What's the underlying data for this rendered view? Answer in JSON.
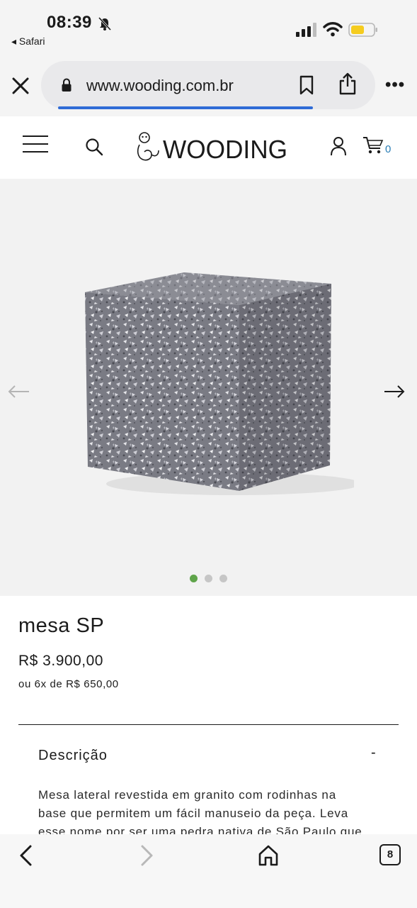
{
  "status_bar": {
    "time": "08:39",
    "back_app": "◂ Safari",
    "icons": [
      "bell-slash-icon",
      "signal-icon",
      "wifi-icon",
      "battery-icon"
    ]
  },
  "browser": {
    "url": "www.wooding.com.br",
    "load_progress": 0.85,
    "icons": [
      "close-icon",
      "lock-icon",
      "bookmark-icon",
      "share-icon",
      "more-icon"
    ],
    "more_label": "•••"
  },
  "site_header": {
    "logo_text": "WOODING",
    "cart_count": "0",
    "icons": [
      "menu-icon",
      "search-icon",
      "user-icon",
      "cart-icon"
    ],
    "accent_color": "#2b7fb7"
  },
  "gallery": {
    "image": "granite-cube-table",
    "slides": 3,
    "active_slide": 1,
    "active_dot_color": "#5fa44a",
    "icons": [
      "arrow-left-icon",
      "arrow-right-icon"
    ]
  },
  "product": {
    "name": "mesa SP",
    "price": "R$ 3.900,00",
    "installments": "ou 6x de R$ 650,00",
    "description_title": "Descrição",
    "description_toggle": "-",
    "description_lines": [
      "Mesa lateral revestida em granito com rodinhas na",
      "base que permitem um fácil manuseio da peça. Leva",
      "esse nome por ser uma pedra nativa de São Paulo que"
    ]
  },
  "toolbar": {
    "tabs_count": "8",
    "icons": [
      "back-icon",
      "forward-icon",
      "home-icon",
      "tabs-icon"
    ]
  }
}
